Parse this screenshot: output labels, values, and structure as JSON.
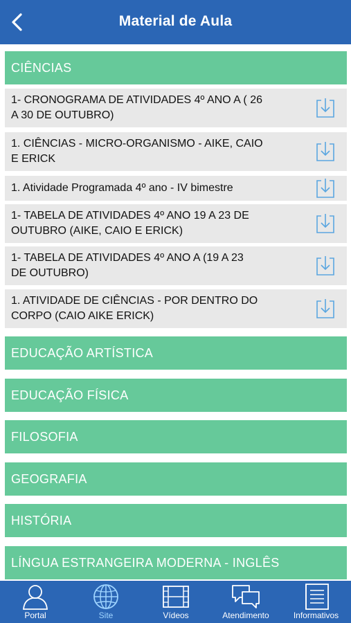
{
  "header": {
    "title": "Material de Aula",
    "back_icon": "chevron-left-icon"
  },
  "sections": [
    {
      "label": "CIÊNCIAS",
      "expanded": true
    },
    {
      "label": "EDUCAÇÃO ARTÍSTICA"
    },
    {
      "label": "EDUCAÇÃO FÍSICA"
    },
    {
      "label": "FILOSOFIA"
    },
    {
      "label": "GEOGRAFIA"
    },
    {
      "label": "HISTÓRIA"
    },
    {
      "label": "LÍNGUA ESTRANGEIRA MODERNA - INGLÊS"
    }
  ],
  "documents": [
    {
      "line1": "1- CRONOGRAMA DE ATIVIDADES 4º ANO A ( 26",
      "line2": "A 30 DE OUTUBRO)"
    },
    {
      "line1": "1. CIÊNCIAS - MICRO-ORGANISMO - AIKE, CAIO",
      "line2": "E ERICK"
    },
    {
      "line1": "1. Atividade Programada 4º ano - IV bimestre",
      "line2": ""
    },
    {
      "line1": "1- TABELA DE ATIVIDADES 4º ANO 19 A  23 DE",
      "line2": "OUTUBRO (AIKE, CAIO E ERICK)"
    },
    {
      "line1": "1- TABELA DE ATIVIDADES 4º ANO A (19 A  23",
      "line2": "DE OUTUBRO)"
    },
    {
      "line1": "1. ATIVIDADE DE CIÊNCIAS - POR DENTRO DO",
      "line2": "CORPO (CAIO AIKE ERICK)"
    }
  ],
  "download_icon": "download-icon",
  "tabbar": {
    "active": "Site",
    "tabs": [
      {
        "label": "Portal",
        "icon": "person-icon"
      },
      {
        "label": "Site",
        "icon": "globe-icon"
      },
      {
        "label": "Vídeos",
        "icon": "film-icon"
      },
      {
        "label": "Atendimento",
        "icon": "chat-bubbles-icon"
      },
      {
        "label": "Informativos",
        "icon": "document-icon"
      }
    ]
  },
  "colors": {
    "header": "#2b66b5",
    "section": "#66c99a",
    "doc_row": "#e8e8e8",
    "icon_blue": "#5aa6e0",
    "active_tab": "#9fd4ff"
  }
}
